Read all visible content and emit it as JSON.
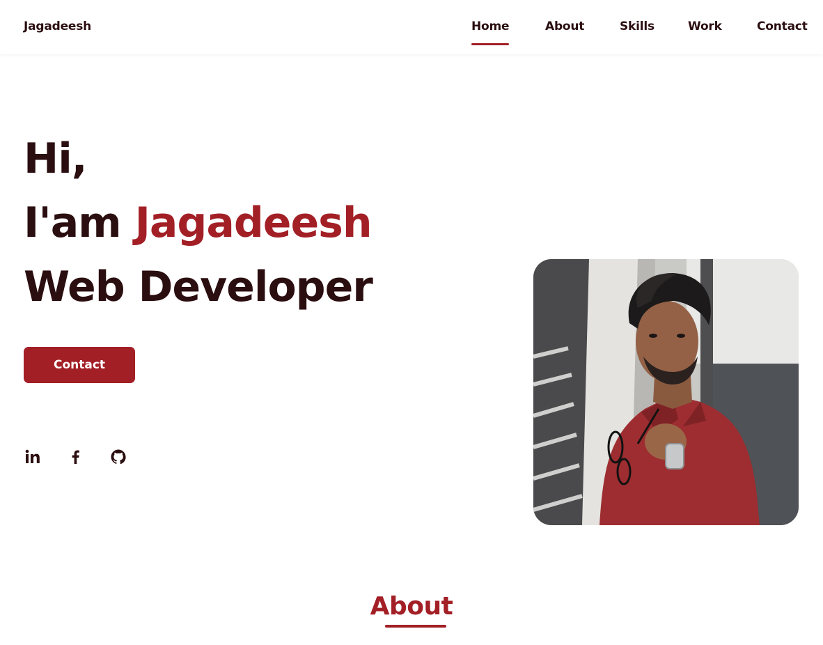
{
  "header": {
    "brand": "Jagadeesh",
    "nav": [
      {
        "label": "Home",
        "active": true
      },
      {
        "label": "About",
        "active": false
      },
      {
        "label": "Skills",
        "active": false
      },
      {
        "label": "Work",
        "active": false
      },
      {
        "label": "Contact",
        "active": false
      }
    ]
  },
  "hero": {
    "greeting": "Hi,",
    "intro_prefix": "I'am",
    "name": "Jagadeesh",
    "role": "Web Developer",
    "cta_label": "Contact",
    "social": [
      {
        "icon": "linkedin-icon"
      },
      {
        "icon": "facebook-icon"
      },
      {
        "icon": "github-icon"
      }
    ],
    "photo": {
      "icon": "profile-photo"
    }
  },
  "about": {
    "title": "About"
  },
  "colors": {
    "accent": "#a31f26",
    "text": "#2b0e10",
    "background": "#ffffff"
  }
}
